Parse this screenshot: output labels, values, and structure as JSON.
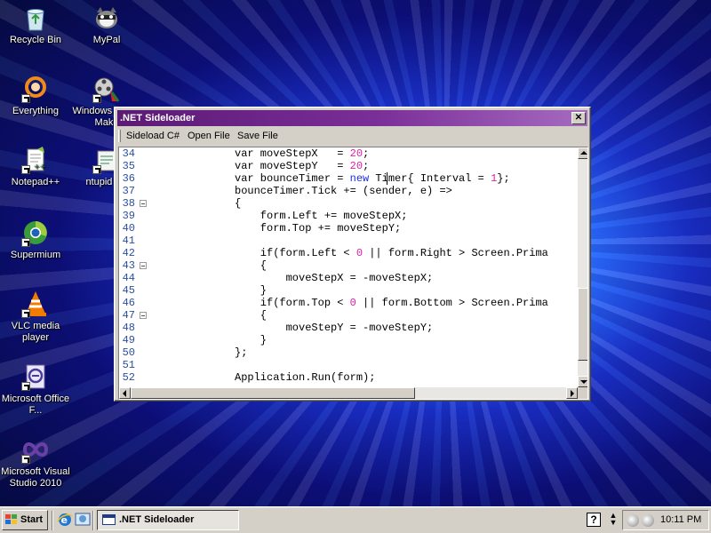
{
  "desktop": {
    "icons": [
      {
        "label": "Recycle Bin",
        "icon": "recycle-bin-icon"
      },
      {
        "label": "MyPal",
        "icon": "mypal-icon"
      },
      {
        "label": "Everything",
        "icon": "everything-icon"
      },
      {
        "label": "Windows Movie Make",
        "icon": "movie-maker-icon"
      },
      {
        "label": "Notepad++",
        "icon": "notepadpp-icon"
      },
      {
        "label": "ntupid sig",
        "icon": "ntupid-icon"
      },
      {
        "label": "Supermium",
        "icon": "supermium-icon"
      },
      {
        "label": "VLC media player",
        "icon": "vlc-icon"
      },
      {
        "label": "Microsoft Office F...",
        "icon": "office-icon"
      },
      {
        "label": "Microsoft Visual Studio 2010",
        "icon": "visual-studio-icon"
      }
    ]
  },
  "window": {
    "title": ".NET Sideloader",
    "close_label": "✕",
    "title_color": "#5b1a74",
    "menu": [
      "Sideload C#",
      "Open File",
      "Save File"
    ]
  },
  "editor": {
    "lines": [
      {
        "num": "34",
        "fold": false,
        "segs": [
          {
            "t": "var moveStepX   = ",
            "c": ""
          },
          {
            "t": "20",
            "c": "num"
          },
          {
            "t": ";",
            "c": ""
          }
        ]
      },
      {
        "num": "35",
        "fold": false,
        "segs": [
          {
            "t": "var moveStepY   = ",
            "c": ""
          },
          {
            "t": "20",
            "c": "num"
          },
          {
            "t": ";",
            "c": ""
          }
        ]
      },
      {
        "num": "36",
        "fold": false,
        "segs": [
          {
            "t": "var bounceTimer = ",
            "c": ""
          },
          {
            "t": "new",
            "c": "kw"
          },
          {
            "t": " Timer{ Interval = ",
            "c": ""
          },
          {
            "t": "1",
            "c": "num"
          },
          {
            "t": "};",
            "c": ""
          }
        ]
      },
      {
        "num": "37",
        "fold": false,
        "segs": [
          {
            "t": "bounceTimer.Tick += (sender, e) =>",
            "c": ""
          }
        ]
      },
      {
        "num": "38",
        "fold": true,
        "segs": [
          {
            "t": "{",
            "c": ""
          }
        ]
      },
      {
        "num": "39",
        "fold": false,
        "segs": [
          {
            "t": "    form.Left += moveStepX;",
            "c": ""
          }
        ]
      },
      {
        "num": "40",
        "fold": false,
        "segs": [
          {
            "t": "    form.Top += moveStepY;",
            "c": ""
          }
        ]
      },
      {
        "num": "41",
        "fold": false,
        "segs": [
          {
            "t": "",
            "c": ""
          }
        ]
      },
      {
        "num": "42",
        "fold": false,
        "segs": [
          {
            "t": "    if(form.Left < ",
            "c": ""
          },
          {
            "t": "0",
            "c": "num"
          },
          {
            "t": " || form.Right > Screen.Prima",
            "c": ""
          }
        ]
      },
      {
        "num": "43",
        "fold": true,
        "segs": [
          {
            "t": "    {",
            "c": ""
          }
        ]
      },
      {
        "num": "44",
        "fold": false,
        "segs": [
          {
            "t": "        moveStepX = -moveStepX;",
            "c": ""
          }
        ]
      },
      {
        "num": "45",
        "fold": false,
        "segs": [
          {
            "t": "    }",
            "c": ""
          }
        ]
      },
      {
        "num": "46",
        "fold": false,
        "segs": [
          {
            "t": "    if(form.Top < ",
            "c": ""
          },
          {
            "t": "0",
            "c": "num"
          },
          {
            "t": " || form.Bottom > Screen.Prima",
            "c": ""
          }
        ]
      },
      {
        "num": "47",
        "fold": true,
        "segs": [
          {
            "t": "    {",
            "c": ""
          }
        ]
      },
      {
        "num": "48",
        "fold": false,
        "segs": [
          {
            "t": "        moveStepY = -moveStepY;",
            "c": ""
          }
        ]
      },
      {
        "num": "49",
        "fold": false,
        "segs": [
          {
            "t": "    }",
            "c": ""
          }
        ]
      },
      {
        "num": "50",
        "fold": false,
        "segs": [
          {
            "t": "};",
            "c": ""
          }
        ]
      },
      {
        "num": "51",
        "fold": false,
        "segs": [
          {
            "t": "",
            "c": ""
          }
        ]
      },
      {
        "num": "52",
        "fold": false,
        "segs": [
          {
            "t": "Application.Run(form);",
            "c": ""
          }
        ]
      }
    ],
    "colors": {
      "number": "#e01fa8",
      "keyword": "#1d2be0",
      "line_number": "#2b4f9e"
    }
  },
  "taskbar": {
    "start_label": "Start",
    "task_label": ".NET Sideloader",
    "help_label": "?",
    "clock": "10:11 PM"
  }
}
